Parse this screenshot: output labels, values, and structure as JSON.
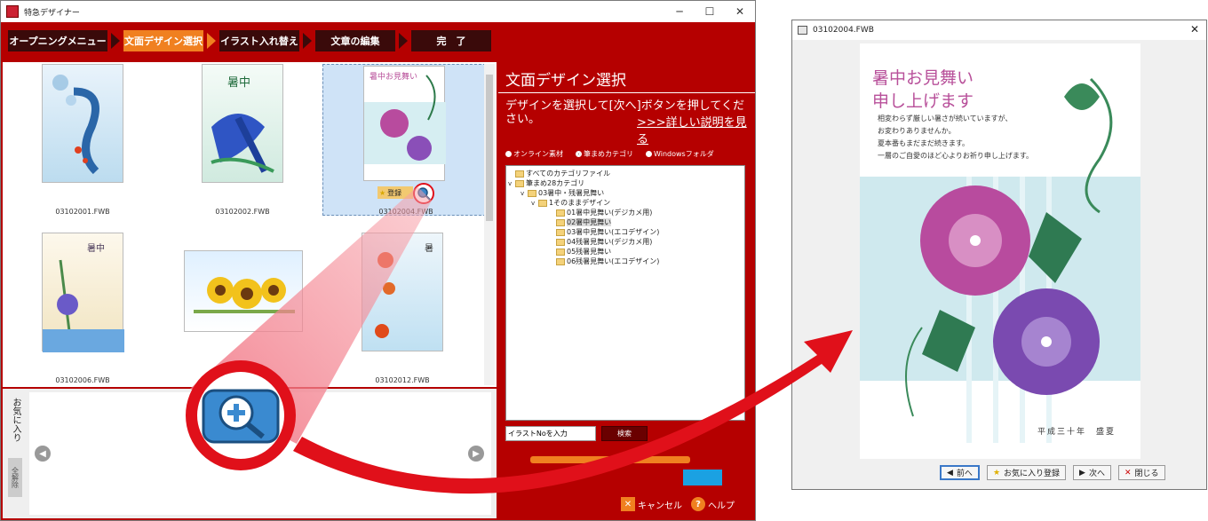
{
  "window": {
    "title": "特急デザイナー",
    "controls": [
      "─",
      "☐",
      "✕"
    ]
  },
  "steps": [
    {
      "label": "オープニングメニュー",
      "active": false
    },
    {
      "label": "文面デザイン選択",
      "active": true
    },
    {
      "label": "イラスト入れ替え",
      "active": false
    },
    {
      "label": "文章の編集",
      "active": false
    },
    {
      "label": "完　了",
      "active": false
    }
  ],
  "gallery": {
    "items": [
      {
        "file": "03102001.FWB"
      },
      {
        "file": "03102002.FWB"
      },
      {
        "file": "03102004.FWB",
        "selected": true,
        "favorite_label": "登録"
      },
      {
        "file": "03102006.FWB"
      },
      {
        "file": ""
      },
      {
        "file": "03102012.FWB"
      }
    ]
  },
  "favorites": {
    "label": "お気に入り",
    "clear_all": "全解除"
  },
  "panel": {
    "title": "文面デザイン選択",
    "description": "デザインを選択して[次へ]ボタンを押してください。",
    "link": ">>>詳しい説明を見る",
    "radios": [
      {
        "label": "オンライン素材",
        "selected": false
      },
      {
        "label": "筆まめカテゴリ",
        "selected": true
      },
      {
        "label": "Windowsフォルダ",
        "selected": false
      }
    ],
    "tree": [
      {
        "label": "すべてのカテゴリファイル",
        "level": 0,
        "exp": ""
      },
      {
        "label": "筆まめ28カテゴリ",
        "level": 0,
        "exp": "v"
      },
      {
        "label": "03暑中・残暑見舞い",
        "level": 1,
        "exp": "v"
      },
      {
        "label": "1そのままデザイン",
        "level": 2,
        "exp": "v"
      },
      {
        "label": "01暑中見舞い(デジカメ用)",
        "level": 3,
        "exp": ""
      },
      {
        "label": "02暑中見舞い",
        "level": 3,
        "exp": "",
        "selected": true
      },
      {
        "label": "03暑中見舞い(エコデザイン)",
        "level": 3,
        "exp": ""
      },
      {
        "label": "04残暑見舞い(デジカメ用)",
        "level": 3,
        "exp": ""
      },
      {
        "label": "05残暑見舞い",
        "level": 3,
        "exp": ""
      },
      {
        "label": "06残暑見舞い(エコデザイン)",
        "level": 3,
        "exp": ""
      }
    ],
    "search_placeholder": "イラストNoを入力",
    "search_button": "検索",
    "cancel": "キャンセル",
    "help": "ヘルプ"
  },
  "preview": {
    "title": "03102004.FWB",
    "greeting_line1": "暑中お見舞い",
    "greeting_line2": "申し上げます",
    "body": [
      "相変わらず厳しい暑さが続いていますが、",
      "お変わりありませんか。",
      "夏本番もまだまだ続きます。",
      "一層のご自愛のほど心よりお祈り申し上げます。"
    ],
    "date": "平成三十年　盛夏",
    "buttons": {
      "prev": "前へ",
      "favorite": "お気に入り登録",
      "next": "次へ",
      "close": "閉じる"
    }
  },
  "colors": {
    "app_red": "#b50000",
    "step_dark": "#3a0a0a",
    "step_active": "#f08020",
    "highlight_red": "#e0101a"
  }
}
